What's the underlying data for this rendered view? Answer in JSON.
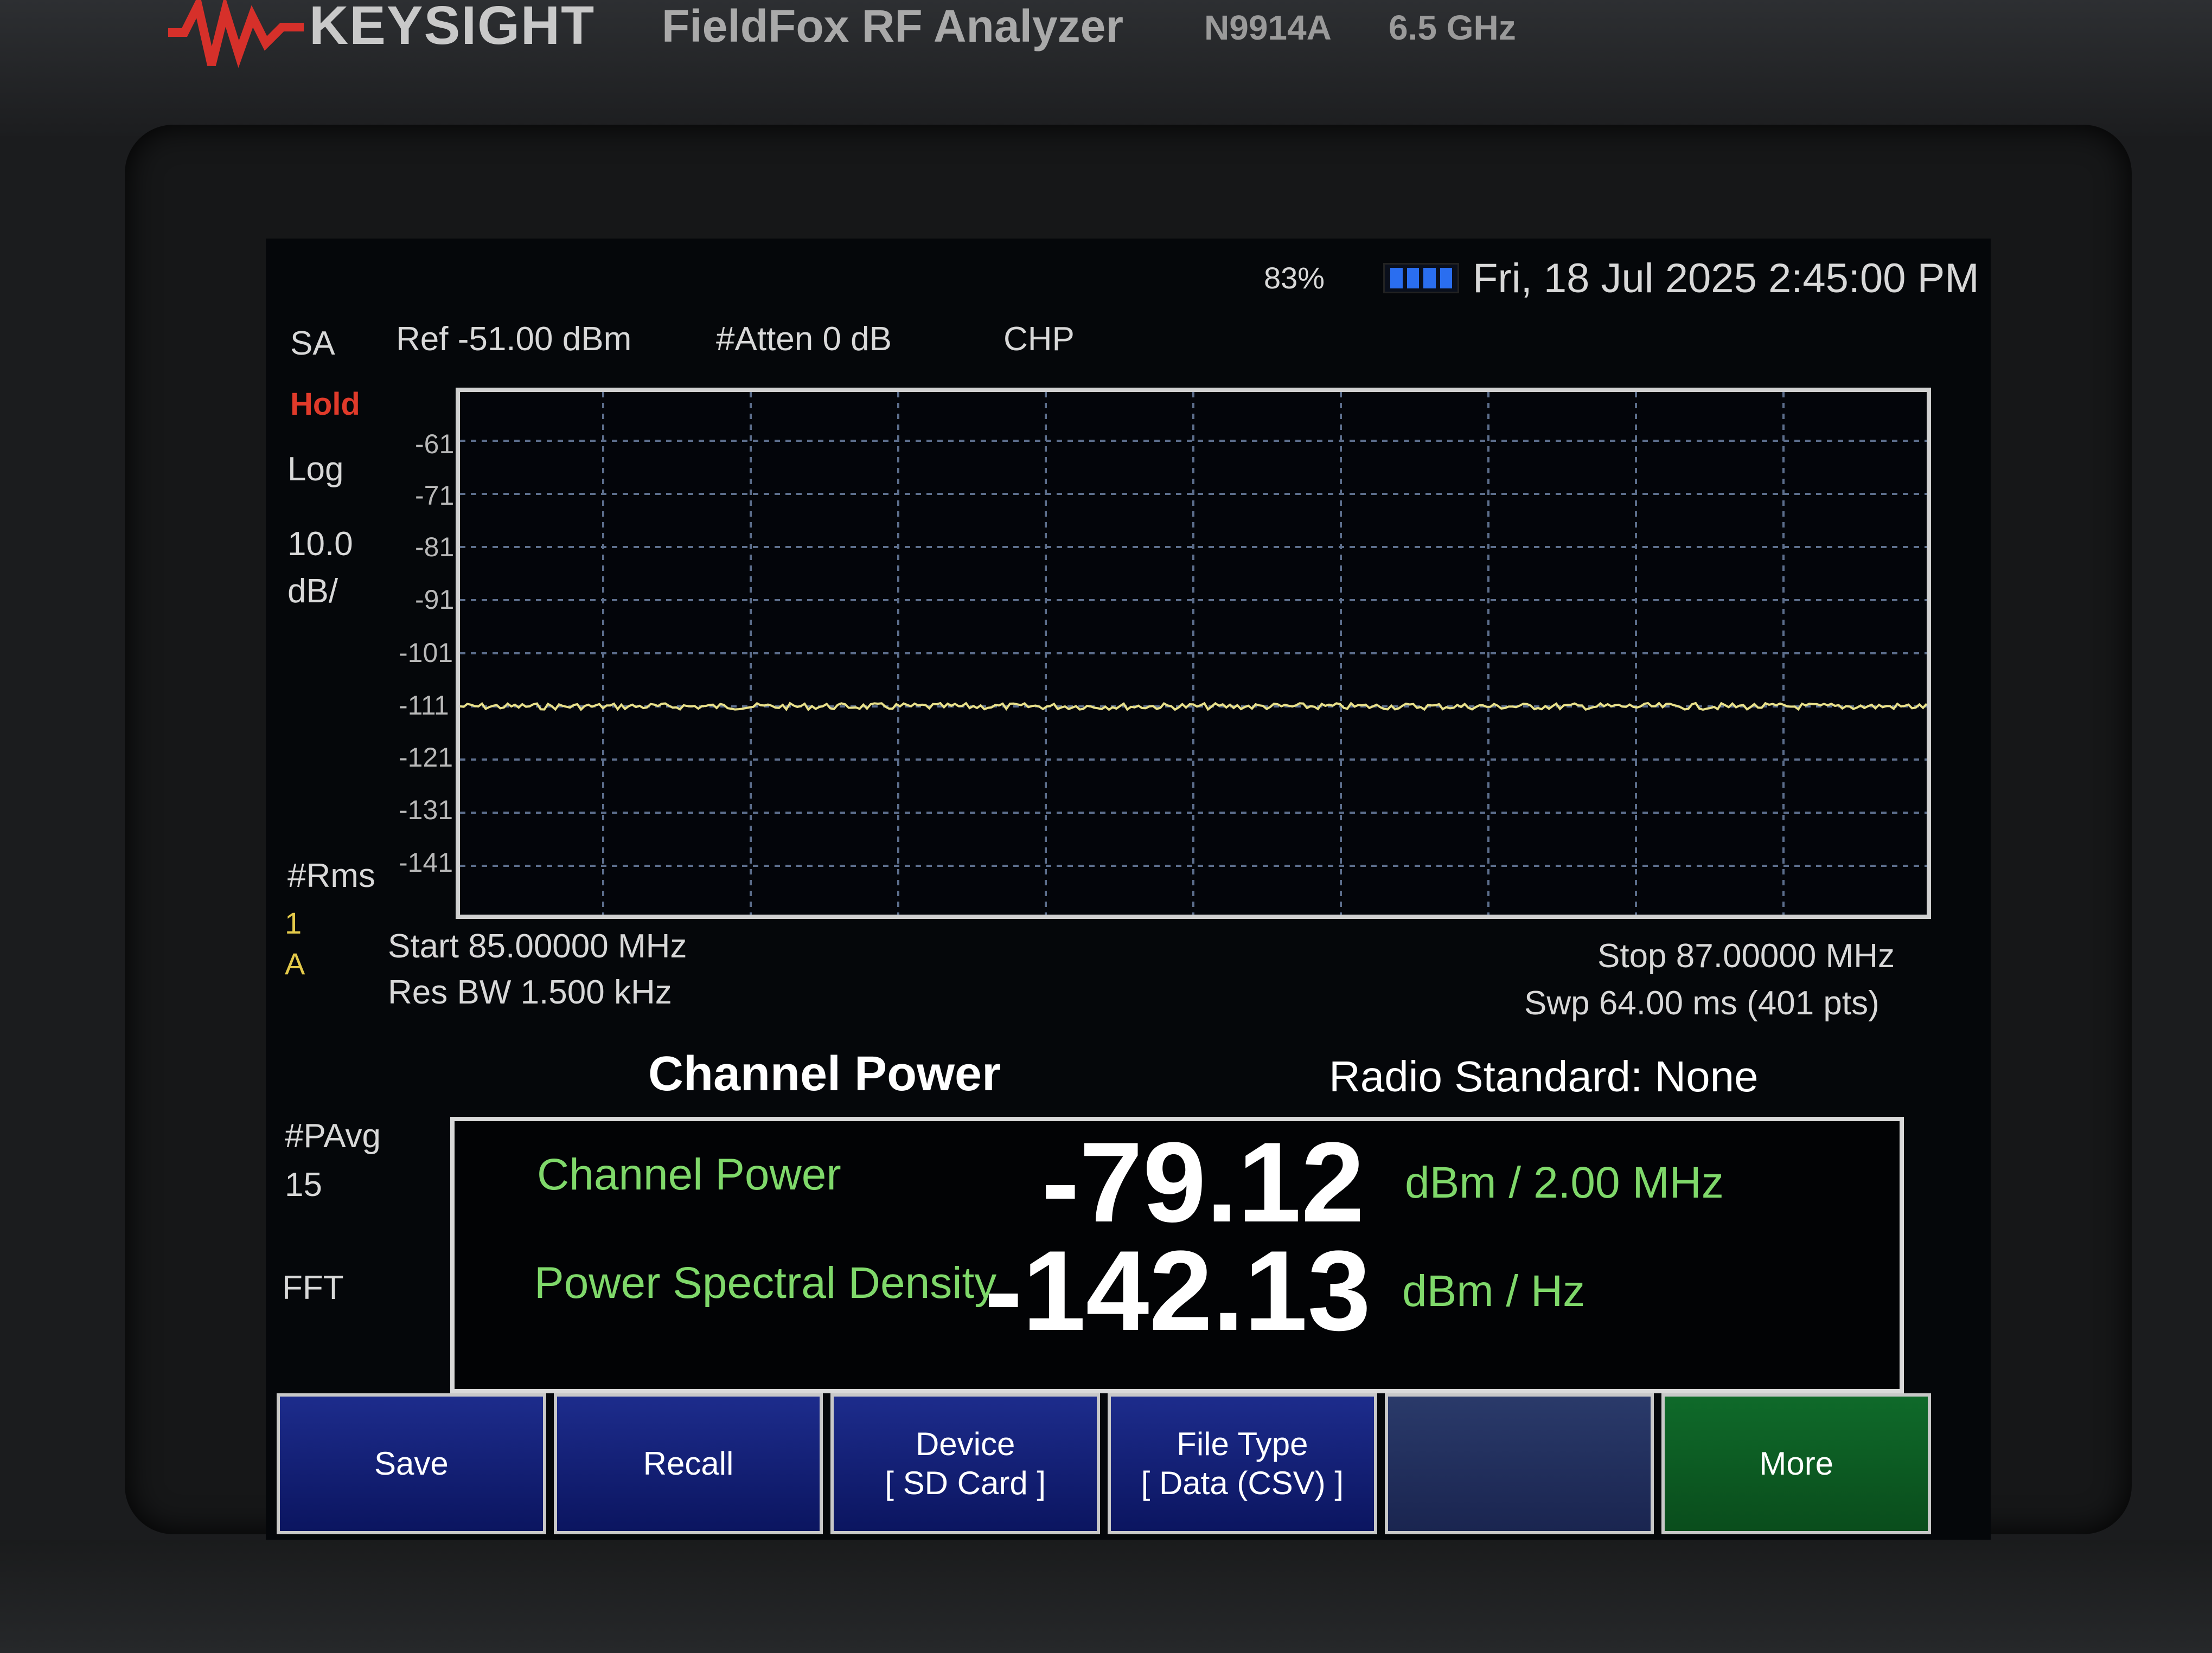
{
  "device": {
    "brand": "KEYSIGHT",
    "product": "FieldFox RF Analyzer",
    "model": "N9914A",
    "frequency": "6.5 GHz"
  },
  "status": {
    "battery_percent": "83%",
    "datetime": "Fri, 18 Jul 2025 2:45:00 PM"
  },
  "header": {
    "mode": "SA",
    "ref": "Ref -51.00 dBm",
    "atten": "#Atten 0 dB",
    "measurement": "CHP"
  },
  "left_panel": {
    "hold": "Hold",
    "scale_type": "Log",
    "scale_value": "10.0",
    "scale_unit": "dB/",
    "detector": "#Rms",
    "trace_num": "1",
    "trace_letter": "A",
    "pavg": "#PAvg",
    "pavg_count": "15",
    "fft": "FFT"
  },
  "y_ticks": [
    "-61",
    "-71",
    "-81",
    "-91",
    "-101",
    "-111",
    "-121",
    "-131",
    "-141"
  ],
  "sweep": {
    "start": "Start 85.00000 MHz",
    "stop": "Stop 87.00000 MHz",
    "rbw": "Res BW 1.500 kHz",
    "swp": "Swp 64.00 ms (401 pts)"
  },
  "results": {
    "title": "Channel Power",
    "radio_standard": "Radio Standard: None",
    "channel_power_label": "Channel Power",
    "channel_power_value": "-79.12",
    "channel_power_unit": "dBm / 2.00 MHz",
    "psd_label": "Power Spectral Density",
    "psd_value": "-142.13",
    "psd_unit": "dBm / Hz"
  },
  "softkeys": {
    "save": "Save",
    "recall": "Recall",
    "device": "Device",
    "device_sub": "[ SD Card ]",
    "file_type": "File Type",
    "file_type_sub": "[ Data (CSV) ]",
    "more": "More"
  },
  "colors": {
    "trace": "#e8e08a",
    "grid": "#5c6e8c",
    "label_green": "#7fd86a",
    "softkey_blue": "#1d2c8c"
  },
  "chart_data": {
    "type": "line",
    "x_range_mhz": [
      85.0,
      87.0
    ],
    "ylim": [
      -151,
      -51
    ],
    "trace_level_dbm": -111
  }
}
